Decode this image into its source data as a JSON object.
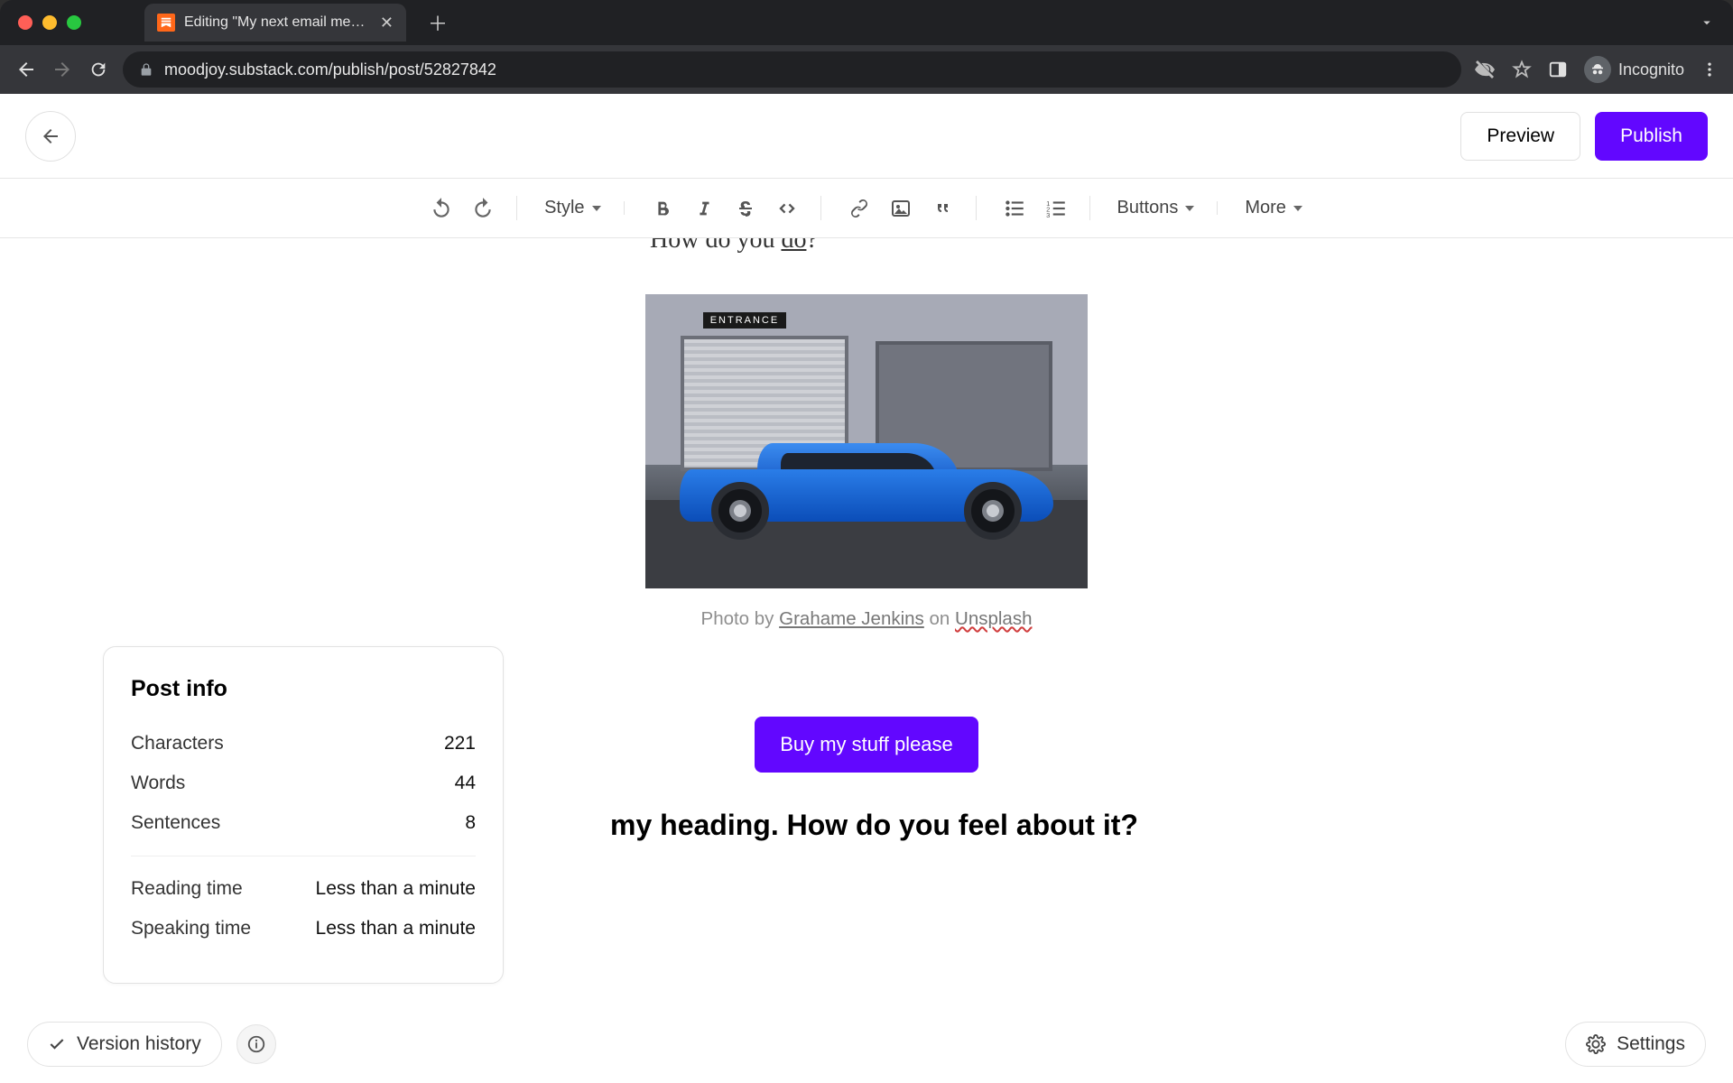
{
  "browser": {
    "tab_title": "Editing \"My next email messag",
    "url": "moodjoy.substack.com/publish/post/52827842",
    "incognito_label": "Incognito"
  },
  "header": {
    "preview": "Preview",
    "publish": "Publish"
  },
  "toolbar": {
    "style": "Style",
    "buttons": "Buttons",
    "more": "More"
  },
  "editor": {
    "body_prefix": "How do you ",
    "body_underline": "do",
    "body_suffix": "?",
    "entrance_sign": "ENTRANCE",
    "caption_prefix": "Photo by ",
    "caption_author": "Grahame Jenkins",
    "caption_on": " on ",
    "caption_source": "Unsplash",
    "cta": "Buy my stuff please",
    "heading_visible": "my heading. How do you feel about it?"
  },
  "post_info": {
    "title": "Post info",
    "rows": {
      "characters_label": "Characters",
      "characters_value": "221",
      "words_label": "Words",
      "words_value": "44",
      "sentences_label": "Sentences",
      "sentences_value": "8",
      "reading_label": "Reading time",
      "reading_value": "Less than a minute",
      "speaking_label": "Speaking time",
      "speaking_value": "Less than a minute"
    }
  },
  "bottom": {
    "version_history": "Version history",
    "settings": "Settings"
  }
}
